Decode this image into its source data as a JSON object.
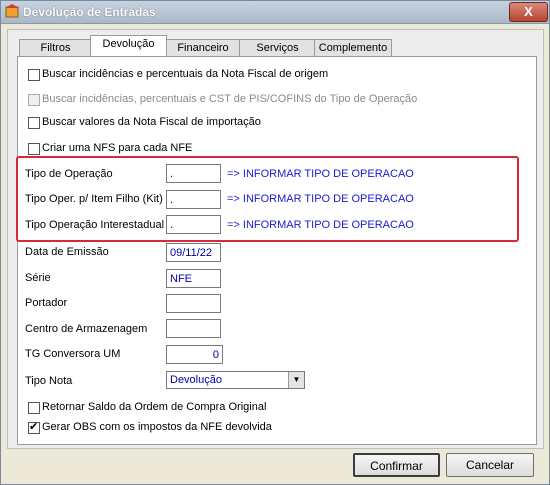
{
  "window": {
    "title": "Devolução de Entradas",
    "close_label": "X"
  },
  "tabs": [
    {
      "label": "Filtros"
    },
    {
      "label": "Devolução"
    },
    {
      "label": "Financeiro"
    },
    {
      "label": "Serviços"
    },
    {
      "label": "Complemento"
    }
  ],
  "checkboxes": {
    "buscar_incidencias": {
      "label": "Buscar incidências e percentuais da Nota Fiscal de origem",
      "checked": false
    },
    "buscar_pis_cofins": {
      "label": "Buscar incidências, percentuais e CST de PIS/COFINS do Tipo de Operação",
      "checked": false,
      "disabled": true
    },
    "buscar_importacao": {
      "label": "Buscar valores da Nota Fiscal de importação",
      "checked": false
    },
    "criar_nfs": {
      "label": "Criar uma NFS para cada NFE",
      "checked": false
    }
  },
  "operacoes": {
    "tipo_operacao": {
      "label": "Tipo de Operação",
      "value": ".",
      "info": "=> INFORMAR TIPO DE OPERACAO"
    },
    "tipo_oper_item": {
      "label": "Tipo Oper. p/ Item Filho (Kit)",
      "value": ".",
      "info": "=> INFORMAR TIPO DE OPERACAO"
    },
    "tipo_oper_interestadual": {
      "label": "Tipo Operação Interestadual",
      "value": ".",
      "info": "=> INFORMAR TIPO DE OPERACAO"
    }
  },
  "fields": {
    "data_emissao": {
      "label": "Data de Emissão",
      "value": "09/11/22"
    },
    "serie": {
      "label": "Série",
      "value": "NFE"
    },
    "portador": {
      "label": "Portador",
      "value": ""
    },
    "centro_armazenagem": {
      "label": "Centro de Armazenagem",
      "value": ""
    },
    "tg_conversora": {
      "label": "TG Conversora UM",
      "value": "0"
    },
    "tipo_nota": {
      "label": "Tipo Nota",
      "value": "Devolução"
    }
  },
  "bottom_checks": {
    "retornar_saldo": {
      "label": "Retornar Saldo da Ordem de Compra Original",
      "checked": false
    },
    "gerar_obs": {
      "label": "Gerar OBS com os impostos da NFE devolvida",
      "checked": true
    }
  },
  "buttons": {
    "confirmar": "Confirmar",
    "cancelar": "Cancelar"
  },
  "colors": {
    "highlight": "#d9283a",
    "info_text": "#1a1ad0",
    "value_text": "#0000a8"
  }
}
